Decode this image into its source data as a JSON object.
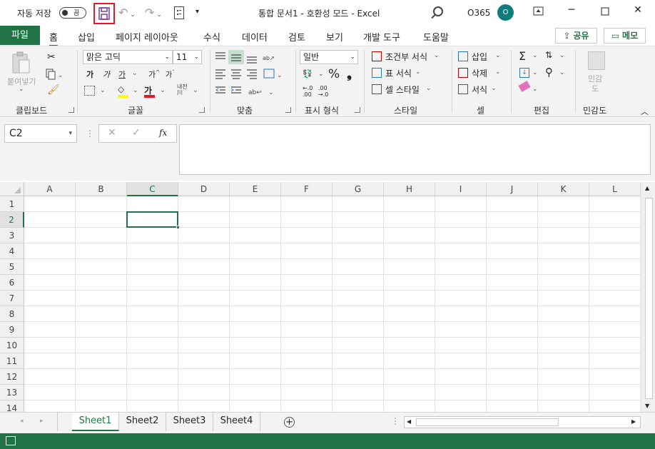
{
  "titlebar": {
    "autosave_label": "자동 저장",
    "autosave_state": "끔",
    "document_title": "통합 문서1 - 호환성 모드 - Excel",
    "user_name": "O365",
    "avatar_initial": "O"
  },
  "tabs": {
    "file": "파일",
    "items": [
      "홈",
      "삽입",
      "페이지 레이아웃",
      "수식",
      "데이터",
      "검토",
      "보기",
      "개발 도구",
      "도움말"
    ],
    "share": "공유",
    "comments": "메모"
  },
  "ribbon": {
    "clipboard": {
      "label": "클립보드",
      "paste": "붙여넣기"
    },
    "font": {
      "label": "글꼴",
      "font_name": "맑은 고딕",
      "font_size": "11",
      "bold": "가",
      "italic": "가",
      "underline": "가",
      "grow": "가",
      "shrink": "가"
    },
    "alignment": {
      "label": "맞춤"
    },
    "number": {
      "label": "표시 형식",
      "format": "일반"
    },
    "styles": {
      "label": "스타일",
      "conditional": "조건부 서식",
      "table": "표 서식",
      "cell_styles": "셀 스타일"
    },
    "cells": {
      "label": "셀",
      "insert": "삽입",
      "delete": "삭제",
      "format": "서식"
    },
    "editing": {
      "label": "편집"
    },
    "sensitivity": {
      "label": "민감도",
      "button": "민감\n도"
    }
  },
  "formula_bar": {
    "name_box": "C2",
    "content": ""
  },
  "grid": {
    "columns": [
      "A",
      "B",
      "C",
      "D",
      "E",
      "F",
      "G",
      "H",
      "I",
      "J",
      "K",
      "L"
    ],
    "rows": [
      "1",
      "2",
      "3",
      "4",
      "5",
      "6",
      "7",
      "8",
      "9",
      "10",
      "11",
      "12",
      "13",
      "14"
    ],
    "active_cell": "C2"
  },
  "sheets": {
    "tabs": [
      "Sheet1",
      "Sheet2",
      "Sheet3",
      "Sheet4"
    ],
    "active": "Sheet1"
  },
  "colors": {
    "accent": "#217346",
    "highlight": "#e3172a",
    "avatar": "#0f7b7b"
  }
}
